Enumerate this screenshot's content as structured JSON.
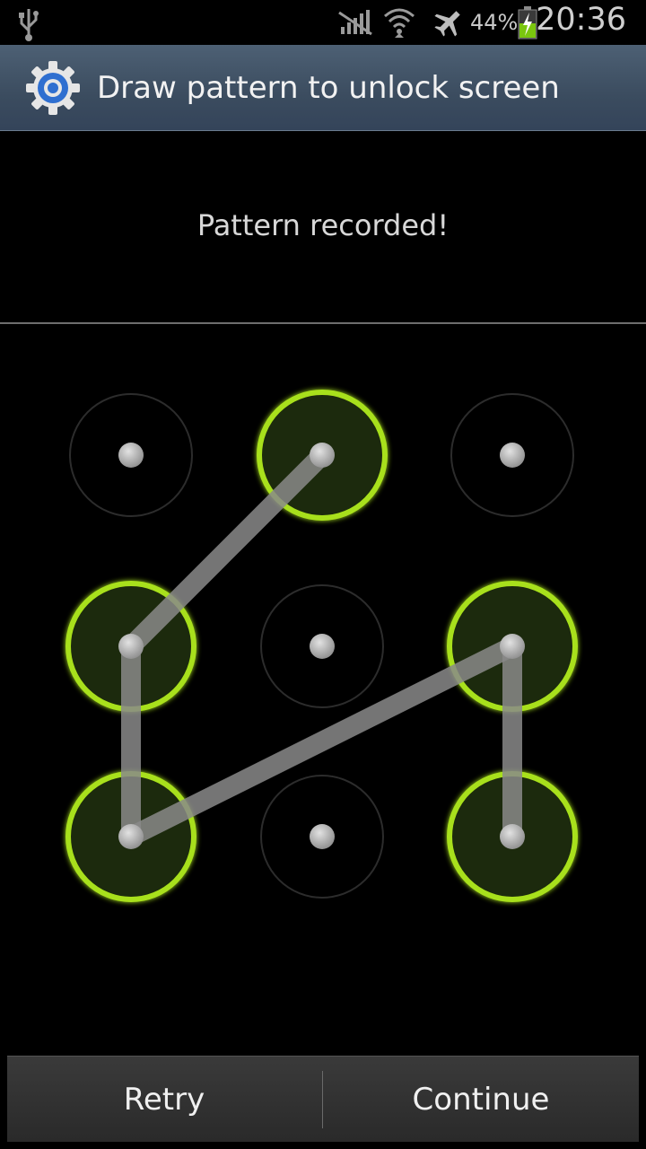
{
  "status_bar": {
    "battery_percent": "44%",
    "time": "20:36",
    "icons": [
      "usb-icon",
      "no-signal-icon",
      "wifi-icon",
      "airplane-mode-icon",
      "battery-charging-icon"
    ]
  },
  "title_bar": {
    "icon": "settings-gear-icon",
    "title": "Draw pattern to unlock screen"
  },
  "message": "Pattern recorded!",
  "pattern": {
    "selected_cells": [
      1,
      3,
      6,
      5,
      8
    ],
    "accent_color": "#a8e01c",
    "line_color": "#8a8a8a"
  },
  "buttons": {
    "retry": "Retry",
    "continue": "Continue"
  }
}
